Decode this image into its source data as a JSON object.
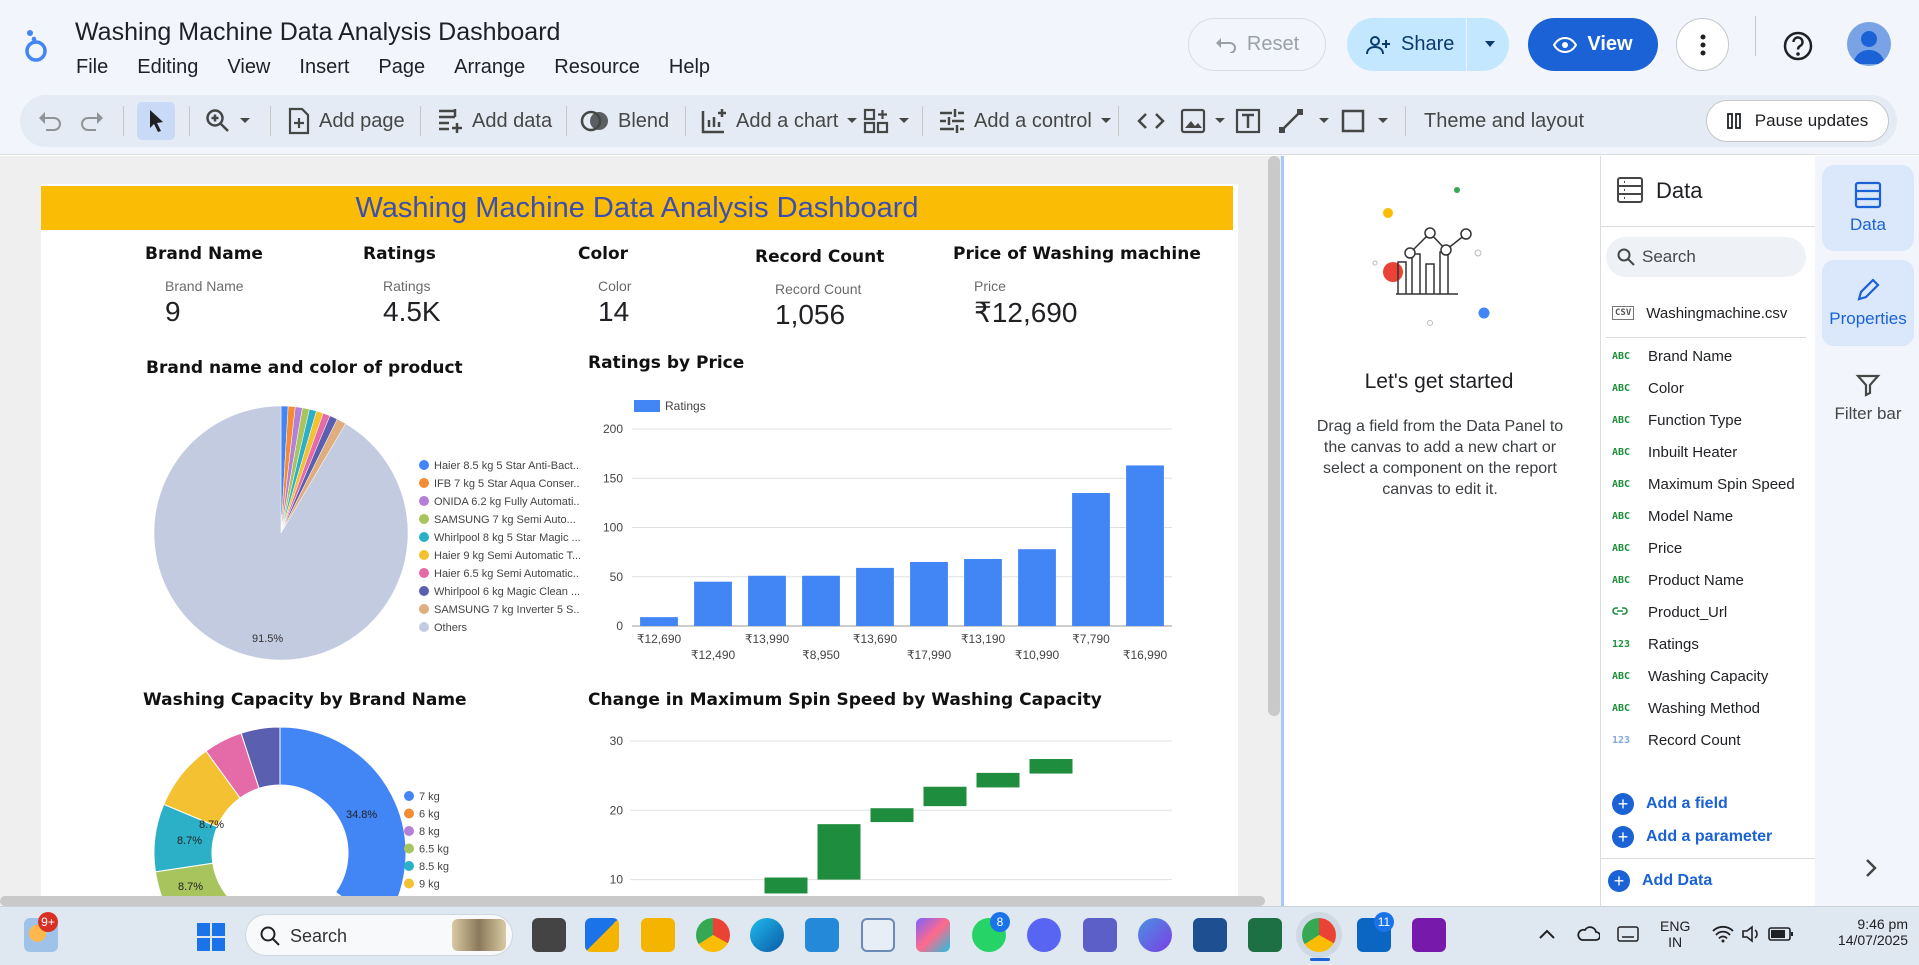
{
  "app": {
    "doc_title": "Washing Machine Data Analysis Dashboard",
    "menu": [
      "File",
      "Editing",
      "View",
      "Insert",
      "Page",
      "Arrange",
      "Resource",
      "Help"
    ],
    "reset_label": "Reset",
    "share_label": "Share",
    "view_label": "View"
  },
  "toolbar": {
    "add_page": "Add page",
    "add_data": "Add data",
    "blend": "Blend",
    "add_chart": "Add a chart",
    "add_control": "Add a control",
    "theme": "Theme and layout",
    "pause": "Pause updates"
  },
  "report": {
    "banner": "Washing Machine Data Analysis Dashboard",
    "scorecards": [
      {
        "header": "Brand Name",
        "label": "Brand Name",
        "value": "9"
      },
      {
        "header": "Ratings",
        "label": "Ratings",
        "value": "4.5K"
      },
      {
        "header": "Color",
        "label": "Color",
        "value": "14"
      },
      {
        "header": "Record Count",
        "label": "Record Count",
        "value": "1,056"
      },
      {
        "header": "Price of Washing machine",
        "label": "Price",
        "value": "₹12,690"
      }
    ],
    "titles": {
      "pie": "Brand name and color of product",
      "bar": "Ratings by Price",
      "donut": "Washing Capacity by Brand Name",
      "waterfall": "Change in Maximum Spin Speed by Washing Capacity"
    }
  },
  "chart_data": [
    {
      "type": "pie",
      "title": "Brand name and color of product",
      "categories": [
        "Haier 8.5 kg 5 Star Anti-Bact...",
        "IFB 7 kg 5 Star Aqua Conser...",
        "ONIDA 6.2 kg Fully Automati...",
        "SAMSUNG 7 kg Semi Auto...",
        "Whirlpool 8 kg 5 Star Magic ...",
        "Haier 9 kg Semi Automatic T...",
        "Haier 6.5 kg Semi Automatic...",
        "Whirlpool 6 kg Magic Clean ...",
        "SAMSUNG 7 kg Inverter 5 S...",
        "Others"
      ],
      "values": [
        0.9,
        0.9,
        0.9,
        0.9,
        0.9,
        0.9,
        0.9,
        1.0,
        1.2,
        91.5
      ],
      "colors": [
        "#4285f4",
        "#f58b35",
        "#b57ed8",
        "#a8c45c",
        "#2bb0c7",
        "#f4c132",
        "#e56ba8",
        "#5a5fb0",
        "#e0ae7e",
        "#c3cbe1"
      ],
      "data_labels": [
        "91.5%"
      ],
      "legend": "right"
    },
    {
      "type": "bar",
      "title": "Ratings by Price",
      "series": [
        {
          "name": "Ratings",
          "values": [
            9,
            45,
            51,
            51,
            59,
            65,
            68,
            78,
            135,
            163
          ]
        }
      ],
      "categories": [
        "₹12,690",
        "₹12,490",
        "₹13,990",
        "₹8,950",
        "₹13,690",
        "₹17,990",
        "₹13,190",
        "₹10,990",
        "₹7,790",
        "₹16,990"
      ],
      "ylim": [
        0,
        200
      ],
      "yticks": [
        0,
        50,
        100,
        150,
        200
      ],
      "legend": "top-left",
      "grid": true
    },
    {
      "type": "pie",
      "title": "Washing Capacity by Brand Name",
      "categories": [
        "7 kg",
        "6 kg",
        "8 kg",
        "6.5 kg",
        "8.5 kg",
        "9 kg"
      ],
      "values": [
        34.8,
        5,
        5,
        8.7,
        8.7,
        8.7
      ],
      "colors": [
        "#4285f4",
        "#5a5fb0",
        "#e56ba8",
        "#f4c132",
        "#2bb0c7",
        "#a8c45c"
      ],
      "legend_colors": [
        "#4285f4",
        "#f58b35",
        "#b57ed8",
        "#a8c45c",
        "#2bb0c7",
        "#f4c132"
      ],
      "data_labels": [
        "34.8%",
        "8.7%",
        "8.7%",
        "8.7%"
      ],
      "legend": "right"
    },
    {
      "type": "bar",
      "title": "Change in Maximum Spin Speed by Washing Capacity",
      "series": [
        {
          "name": "",
          "ranges": [
            [
              8,
              10.3
            ],
            [
              10,
              18
            ],
            [
              18.3,
              20.3
            ],
            [
              20.6,
              23.4
            ],
            [
              23.3,
              25.4
            ],
            [
              25.3,
              27.4
            ]
          ]
        }
      ],
      "ylim": [
        8,
        30
      ],
      "yticks": [
        10,
        20,
        30
      ],
      "grid": true
    }
  ],
  "get_started": {
    "title": "Let's get started",
    "text": "Drag a field from the Data Panel to the canvas to add a new chart or select a component on the report canvas to edit it."
  },
  "data_panel": {
    "title": "Data",
    "search_placeholder": "Search",
    "source": "Washingmachine.csv",
    "fields": [
      {
        "type": "ABC",
        "name": "Brand Name"
      },
      {
        "type": "ABC",
        "name": "Color"
      },
      {
        "type": "ABC",
        "name": "Function Type"
      },
      {
        "type": "ABC",
        "name": "Inbuilt Heater"
      },
      {
        "type": "ABC",
        "name": "Maximum Spin Speed"
      },
      {
        "type": "ABC",
        "name": "Model Name"
      },
      {
        "type": "ABC",
        "name": "Price"
      },
      {
        "type": "ABC",
        "name": "Product Name"
      },
      {
        "type": "link",
        "name": "Product_Url"
      },
      {
        "type": "123",
        "name": "Ratings"
      },
      {
        "type": "ABC",
        "name": "Washing Capacity"
      },
      {
        "type": "ABC",
        "name": "Washing Method"
      },
      {
        "type": "123",
        "name": "Record Count"
      }
    ],
    "add_field": "Add a field",
    "add_parameter": "Add a parameter",
    "add_data": "Add Data"
  },
  "rail": {
    "data": "Data",
    "properties": "Properties",
    "filter_bar": "Filter bar"
  },
  "taskbar": {
    "search": "Search",
    "weather_badge": "9+",
    "whatsapp_badge": "8",
    "linkedin_badge": "11",
    "lang": "ENG",
    "region": "IN",
    "time": "9:46 pm",
    "date": "14/07/2025"
  }
}
